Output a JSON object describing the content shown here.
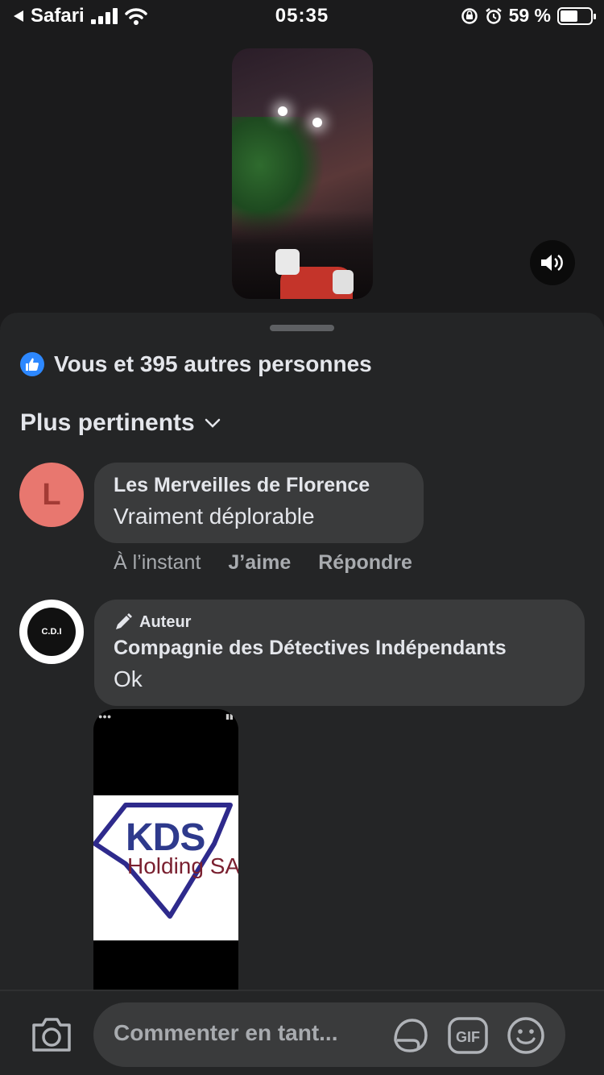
{
  "status_bar": {
    "back_app": "Safari",
    "time": "05:35",
    "battery_percent": "59 %",
    "battery_level": 0.59
  },
  "reactions": {
    "text": "Vous et 395 autres personnes"
  },
  "sort": {
    "label": "Plus pertinents"
  },
  "comments": [
    {
      "avatar_letter": "L",
      "author": "Les Merveilles de Florence",
      "text": "Vraiment déplorable",
      "time": "À l’instant",
      "like_label": "J’aime",
      "reply_label": "Répondre"
    },
    {
      "badge": "Auteur",
      "author": "Compagnie des Détectives Indépendants",
      "text": "Ok",
      "avatar_text": "C.D.I",
      "attachment_text_1": "KDS",
      "attachment_text_2": "Holding SA"
    }
  ],
  "composer": {
    "placeholder": "Commenter en tant..."
  },
  "colors": {
    "background": "#1b1b1c",
    "sheet": "#242526",
    "bubble": "#3a3b3c",
    "like_blue": "#2d88ff",
    "muted_text": "#a8abaf"
  }
}
